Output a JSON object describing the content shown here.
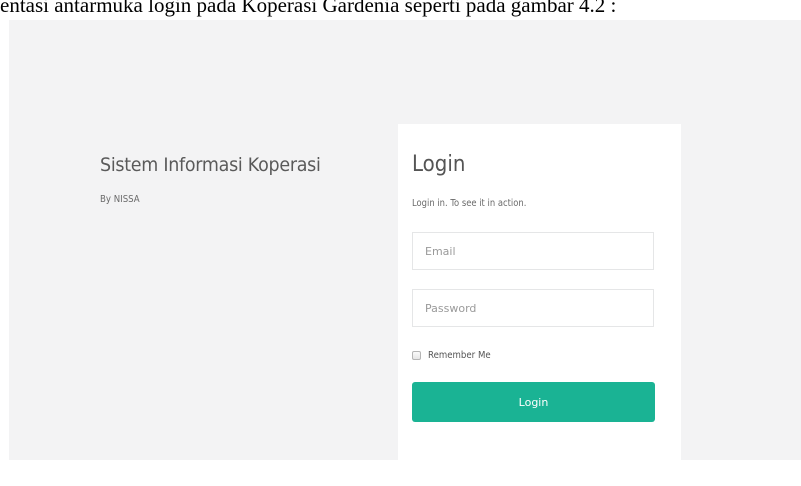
{
  "document": {
    "caption": "entasi antarmuka login pada Koperasi Gardenia seperti pada gambar 4.2 :"
  },
  "brand": {
    "title": "Sistem Informasi Koperasi",
    "subtitle": "By NISSA"
  },
  "login": {
    "title": "Login",
    "subtitle": "Login in. To see it in action.",
    "email_placeholder": "Email",
    "email_value": "",
    "password_placeholder": "Password",
    "password_value": "",
    "remember_label": "Remember Me",
    "remember_checked": false,
    "submit_label": "Login"
  },
  "colors": {
    "page_background": "#f3f3f4",
    "card_background": "#ffffff",
    "primary_button": "#1ab394"
  }
}
